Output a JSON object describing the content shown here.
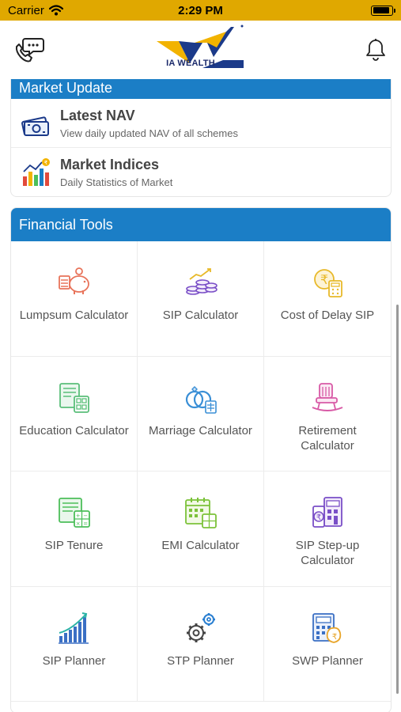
{
  "status_bar": {
    "carrier": "Carrier",
    "time": "2:29 PM",
    "battery_level": 0.9
  },
  "header": {
    "logo_text": "IA WEALTH"
  },
  "market_update": {
    "title": "Market Update",
    "items": [
      {
        "title": "Latest NAV",
        "subtitle": "View daily updated NAV of all schemes",
        "icon": "money-icon"
      },
      {
        "title": "Market Indices",
        "subtitle": "Daily Statistics of Market",
        "icon": "bar-chart-icon"
      }
    ]
  },
  "financial_tools": {
    "title": "Financial Tools",
    "tools": [
      {
        "label": "Lumpsum Calculator",
        "icon": "piggy-bank-icon",
        "color": "#e8735a"
      },
      {
        "label": "SIP Calculator",
        "icon": "coins-stack-icon",
        "color": "#7a4fc7"
      },
      {
        "label": "Cost of Delay SIP",
        "icon": "rupee-calculator-icon",
        "color": "#e8b92a"
      },
      {
        "label": "Education Calculator",
        "icon": "education-icon",
        "color": "#5bbf7a"
      },
      {
        "label": "Marriage Calculator",
        "icon": "rings-icon",
        "color": "#3a8fd6"
      },
      {
        "label": "Retirement Calculator",
        "icon": "rocking-chair-icon",
        "color": "#d85aa6"
      },
      {
        "label": "SIP Tenure",
        "icon": "calculator-list-icon",
        "color": "#4cbf5a"
      },
      {
        "label": "EMI Calculator",
        "icon": "calendar-calculator-icon",
        "color": "#7cc23a"
      },
      {
        "label": "SIP Step-up Calculator",
        "icon": "rupee-calculator-step-icon",
        "color": "#7a4fc7"
      },
      {
        "label": "SIP Planner",
        "icon": "growth-chart-icon",
        "color": "#3a6fc4"
      },
      {
        "label": "STP Planner",
        "icon": "gears-icon",
        "color": "#2a7fd1"
      },
      {
        "label": "SWP Planner",
        "icon": "swp-calculator-icon",
        "color": "#3a6fc4"
      }
    ]
  }
}
